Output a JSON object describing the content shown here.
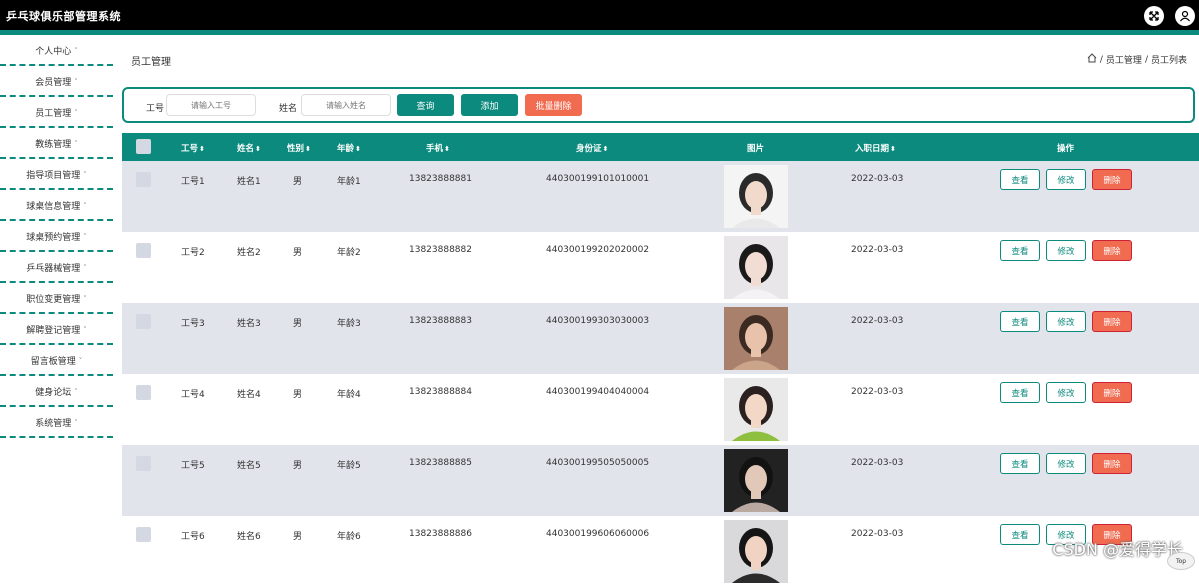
{
  "app_title": "乒乓球俱乐部管理系统",
  "sidebar": {
    "items": [
      {
        "label": "个人中心"
      },
      {
        "label": "会员管理"
      },
      {
        "label": "员工管理"
      },
      {
        "label": "教练管理"
      },
      {
        "label": "指导项目管理"
      },
      {
        "label": "球桌信息管理"
      },
      {
        "label": "球桌预约管理"
      },
      {
        "label": "乒乓器械管理"
      },
      {
        "label": "职位变更管理"
      },
      {
        "label": "解聘登记管理"
      },
      {
        "label": "留言板管理"
      },
      {
        "label": "健身论坛"
      },
      {
        "label": "系统管理"
      }
    ]
  },
  "page_title": "员工管理",
  "breadcrumb": [
    "员工管理",
    "员工列表"
  ],
  "search": {
    "id_label": "工号",
    "id_placeholder": "请输入工号",
    "name_label": "姓名",
    "name_placeholder": "请输入姓名",
    "query_btn": "查询",
    "add_btn": "添加",
    "batch_delete_btn": "批量删除"
  },
  "table": {
    "headers": [
      "工号",
      "姓名",
      "性别",
      "年龄",
      "手机",
      "身份证",
      "图片",
      "入职日期",
      "操作"
    ],
    "rows": [
      {
        "id": "工号1",
        "name": "姓名1",
        "gender": "男",
        "age": "年龄1",
        "phone": "13823888881",
        "idcard": "440300199101010001",
        "date": "2022-03-03"
      },
      {
        "id": "工号2",
        "name": "姓名2",
        "gender": "男",
        "age": "年龄2",
        "phone": "13823888882",
        "idcard": "440300199202020002",
        "date": "2022-03-03"
      },
      {
        "id": "工号3",
        "name": "姓名3",
        "gender": "男",
        "age": "年龄3",
        "phone": "13823888883",
        "idcard": "440300199303030003",
        "date": "2022-03-03"
      },
      {
        "id": "工号4",
        "name": "姓名4",
        "gender": "男",
        "age": "年龄4",
        "phone": "13823888884",
        "idcard": "440300199404040004",
        "date": "2022-03-03"
      },
      {
        "id": "工号5",
        "name": "姓名5",
        "gender": "男",
        "age": "年龄5",
        "phone": "13823888885",
        "idcard": "440300199505050005",
        "date": "2022-03-03"
      },
      {
        "id": "工号6",
        "name": "姓名6",
        "gender": "男",
        "age": "年龄6",
        "phone": "13823888886",
        "idcard": "440300199606060006",
        "date": "2022-03-03"
      }
    ],
    "ops": {
      "view": "查看",
      "edit": "修改",
      "delete": "删除"
    }
  },
  "watermark": "CSDN @爱得学长",
  "back_to_top": "Top",
  "colors": {
    "accent": "#0b8a7d",
    "danger": "#f06b4f",
    "topbar": "#000000"
  },
  "icons": [
    "fullscreen-icon",
    "user-icon",
    "home-icon",
    "sort-icon"
  ]
}
